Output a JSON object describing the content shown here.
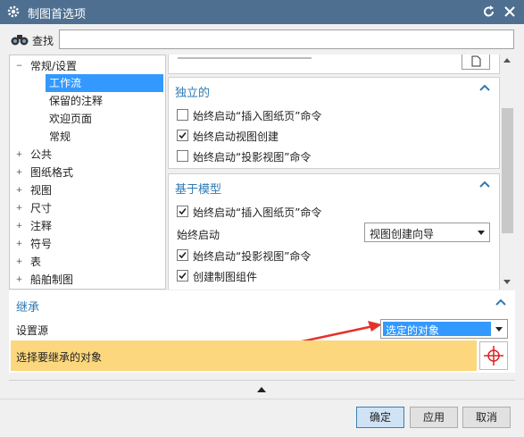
{
  "window": {
    "title": "制图首选项"
  },
  "search": {
    "label": "查找",
    "value": ""
  },
  "tree": {
    "items": [
      {
        "label": "常规/设置",
        "expander": "−"
      },
      {
        "label": "工作流",
        "selected": true
      },
      {
        "label": "保留的注释"
      },
      {
        "label": "欢迎页面"
      },
      {
        "label": "常规"
      },
      {
        "label": "公共",
        "expander": "+"
      },
      {
        "label": "图纸格式",
        "expander": "+"
      },
      {
        "label": "视图",
        "expander": "+"
      },
      {
        "label": "尺寸",
        "expander": "+"
      },
      {
        "label": "注释",
        "expander": "+"
      },
      {
        "label": "符号",
        "expander": "+"
      },
      {
        "label": "表",
        "expander": "+"
      },
      {
        "label": "船舶制图",
        "expander": "+"
      }
    ]
  },
  "standalone": {
    "header": "独立的",
    "options": [
      {
        "label": "始终启动“插入图纸页”命令",
        "checked": false
      },
      {
        "label": "始终启动视图创建",
        "checked": true
      },
      {
        "label": "始终启动“投影视图”命令",
        "checked": false
      }
    ]
  },
  "model_based": {
    "header": "基于模型",
    "opt1": {
      "label": "始终启动“插入图纸页”命令",
      "checked": true
    },
    "always_start": {
      "label": "始终启动",
      "value": "视图创建向导"
    },
    "opt2": {
      "label": "始终启动“投影视图”命令",
      "checked": true
    },
    "opt3": {
      "label": "创建制图组件",
      "checked": true
    }
  },
  "inherit": {
    "header": "继承",
    "source_label": "设置源",
    "source_value": "选定的对象",
    "select_object_label": "选择要继承的对象"
  },
  "buttons": {
    "ok": "确定",
    "apply": "应用",
    "cancel": "取消"
  },
  "colors": {
    "accent": "#2e7ab5",
    "titlebar": "#4f6f90",
    "selection": "#3399ff",
    "highlight_row": "#fcd77d"
  }
}
